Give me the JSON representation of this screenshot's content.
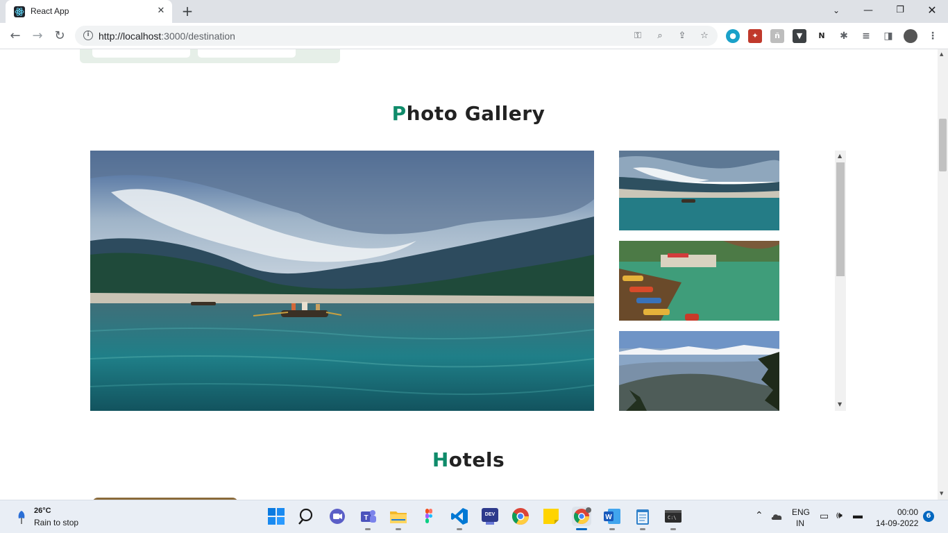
{
  "browser": {
    "tab_title": "React App",
    "url_host": "http://localhost",
    "url_rest": ":3000/destination",
    "window_controls": [
      "minimize",
      "restore",
      "close"
    ]
  },
  "page": {
    "gallery_heading_accent": "P",
    "gallery_heading_rest": "hoto Gallery",
    "hotels_heading_accent": "H",
    "hotels_heading_rest": "otels",
    "gallery_main_image": "lake with rowing boats, mountains and cloudy sky",
    "gallery_thumbnails": [
      "lake with boat and cloudy mountains",
      "colorful boats moored at lake shore",
      "snow peaks over misty hill ranges"
    ]
  },
  "taskbar": {
    "weather_temp": "26°C",
    "weather_desc": "Rain to stop",
    "lang_top": "ENG",
    "lang_bottom": "IN",
    "time": "00:00",
    "date": "14-09-2022",
    "notification_count": "6"
  },
  "colors": {
    "heading_accent": "#0f8b6a",
    "tabstrip": "#dee1e6",
    "taskbar": "#e9eef5"
  }
}
